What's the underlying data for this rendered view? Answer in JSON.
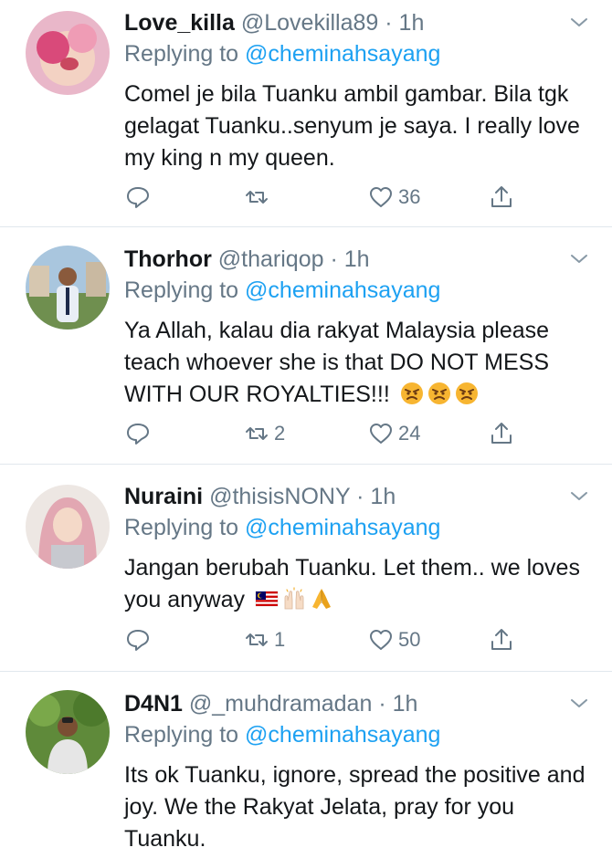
{
  "tweets": [
    {
      "name": "Love_killa",
      "handle": "@Lovekilla89",
      "time": "· 1h",
      "replying_prefix": "Replying to",
      "replying_to": "@cheminahsayang",
      "text": "Comel je bila Tuanku ambil gambar. Bila tgk gelagat Tuanku..senyum je saya. I really love my king n my queen.",
      "retweets": "",
      "likes": "36"
    },
    {
      "name": "Thorhor",
      "handle": "@thariqop",
      "time": "· 1h",
      "replying_prefix": "Replying to",
      "replying_to": "@cheminahsayang",
      "text": "Ya Allah, kalau dia rakyat Malaysia please teach whoever she is that DO NOT MESS WITH OUR ROYALTIES!!!",
      "emojis": [
        "angry-face-emoji",
        "angry-face-emoji",
        "angry-face-emoji"
      ],
      "retweets": "2",
      "likes": "24"
    },
    {
      "name": "Nuraini",
      "handle": "@thisisNONY",
      "time": "· 1h",
      "replying_prefix": "Replying to",
      "replying_to": "@cheminahsayang",
      "text": "Jangan berubah Tuanku. Let them.. we loves you anyway",
      "emojis": [
        "malaysia-flag-emoji",
        "raising-hands-emoji",
        "folded-hands-emoji"
      ],
      "retweets": "1",
      "likes": "50"
    },
    {
      "name": "D4N1",
      "handle": "@_muhdramadan",
      "time": "· 1h",
      "replying_prefix": "Replying to",
      "replying_to": "@cheminahsayang",
      "text": "Its ok Tuanku, ignore, spread the positive and joy. We the Rakyat Jelata, pray for you Tuanku."
    }
  ],
  "colors": {
    "link": "#1da1f2",
    "secondary": "#657786",
    "divider": "#e1e8ed"
  }
}
